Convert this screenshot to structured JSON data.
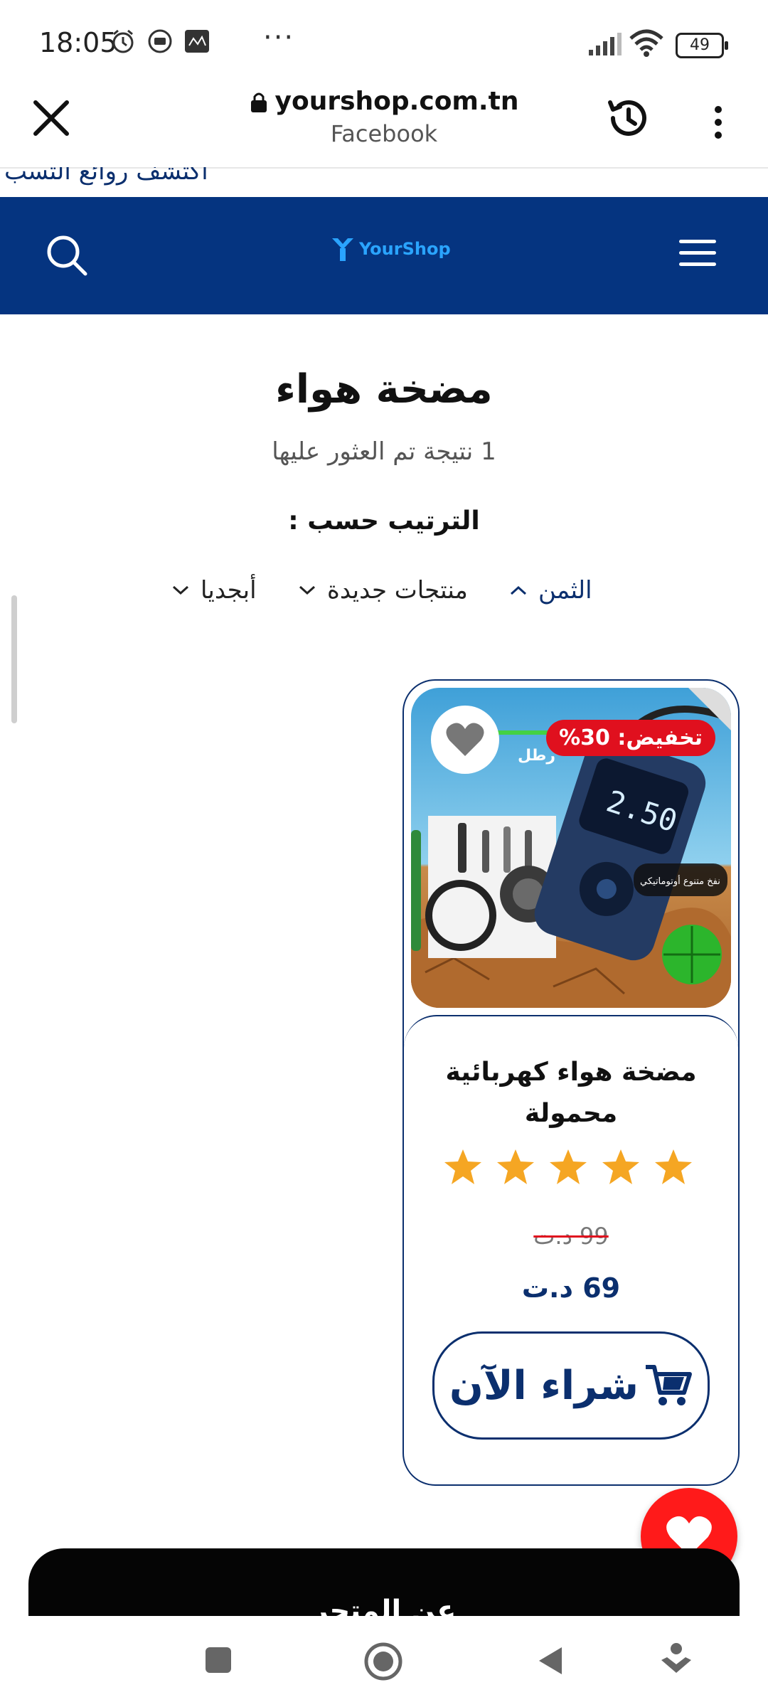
{
  "status_bar": {
    "time": "18:05",
    "battery": "49",
    "overflow": "···"
  },
  "browser": {
    "url": "yourshop.com.tn",
    "subtitle": "Facebook"
  },
  "ticker": {
    "text": "اكتشف روائع التسب"
  },
  "header": {
    "logo_text": "YourShop",
    "brand_color": "#053480",
    "accent_color": "#2aa4ff"
  },
  "page": {
    "title": "مضخة هواء",
    "results": "1 نتيجة تم العثور عليها",
    "sort_label": "الترتيب حسب :",
    "sort_options": [
      "الثمن",
      "منتجات جديدة",
      "أبجديا"
    ]
  },
  "product": {
    "discount": "تخفيض: 30%",
    "image_label_1": "رطل",
    "image_label_2": "نفخ متنوع أوتوماتيكي",
    "image_display": "2.50",
    "title": "مضخة هواء كهربائية محمولة",
    "rating": 5,
    "old_price": "99 د.ت",
    "new_price": "69 د.ت",
    "buy_label": "شراء الآن",
    "discount_color": "#e0101e",
    "star_color": "#f5a623"
  },
  "footer": {
    "title": "عن المتجر"
  },
  "icons": {
    "close": "close-icon",
    "lock": "lock-icon",
    "history": "history-icon",
    "menu": "more-vert-icon",
    "search": "search-icon",
    "hamburger": "hamburger-icon",
    "wishlist": "heart-icon",
    "cart": "cart-icon",
    "fab": "heart-icon"
  }
}
